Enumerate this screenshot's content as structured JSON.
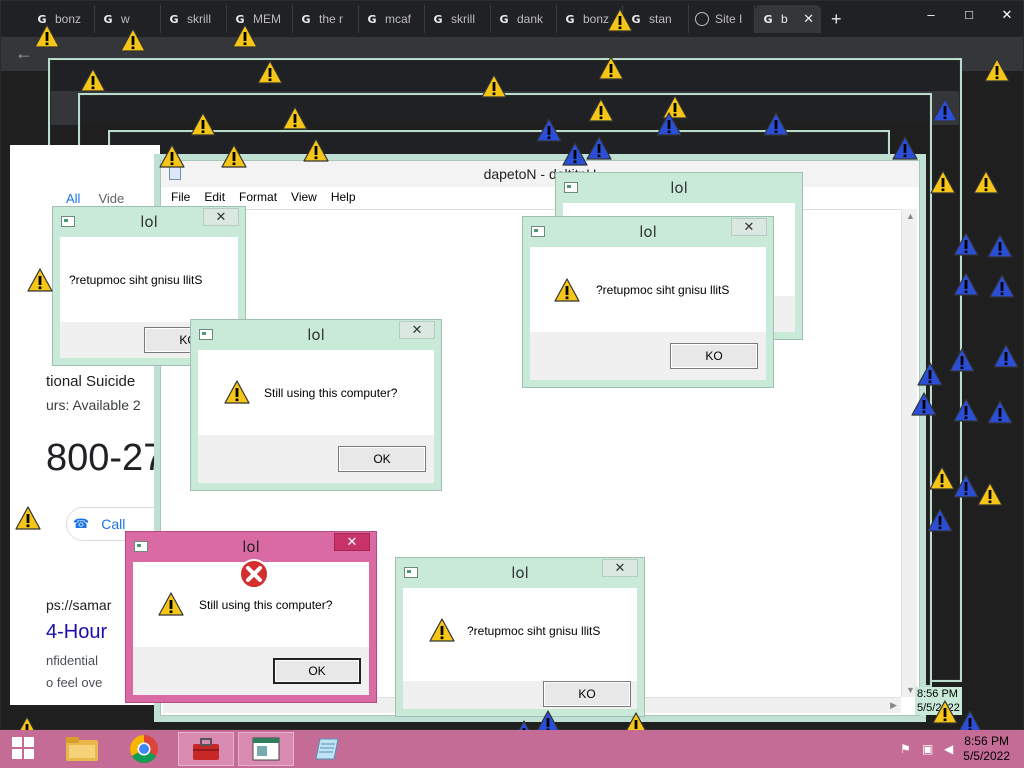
{
  "browser": {
    "tabs": [
      "bonz",
      "w",
      "skrill",
      "MEM",
      "the r",
      "mcaf",
      "skrill",
      "dank",
      "bonz",
      "stan",
      "Site I",
      "b"
    ],
    "active_tab_close": "✕",
    "new_tab": "+",
    "window_controls": {
      "minimize": "–",
      "maximize": "□",
      "close": "✕"
    },
    "back": "←"
  },
  "search_page": {
    "tab_all": "All",
    "tab_videos": "Vide",
    "result_heading": "tional Suicide",
    "hours": "urs: Available 2",
    "phone": "800-27",
    "call_label": "Call",
    "url": "ps://samar",
    "result_title": "4-Hour",
    "confidential": "nfidential",
    "feel": "o feel ove"
  },
  "notepad": {
    "title": "dapetoN - deltitnU",
    "menu": [
      "File",
      "Edit",
      "Format",
      "View",
      "Help"
    ]
  },
  "dialogs": [
    {
      "title": "lol",
      "message": "?retupmoc siht gnisu llitS",
      "button": "KO",
      "close": "✕"
    },
    {
      "title": "lol",
      "message": "?retupmoc siht gnisu llitS",
      "button": "KO",
      "close": "✕"
    },
    {
      "title": "lol",
      "message": "Still using this computer?",
      "button": "OK",
      "close": "✕"
    },
    {
      "title": "lol",
      "message": "Still using this computer?",
      "button": "OK",
      "close": "✕"
    },
    {
      "title": "lol",
      "message": "?retupmoc siht gnisu llitS",
      "button": "KO",
      "close": "✕"
    },
    {
      "title": "lol",
      "close": "✕"
    }
  ],
  "taskbar": {
    "clock_time": "8:56 PM",
    "clock_date": "5/5/2022"
  },
  "mini_clock": {
    "time": "8:56 PM",
    "date": "5/5/2022"
  },
  "colors": {
    "warning": "#f5c518",
    "taskbar": "#c46c96",
    "accent_pink": "#d96aa3",
    "background": "#cfe8dc"
  }
}
